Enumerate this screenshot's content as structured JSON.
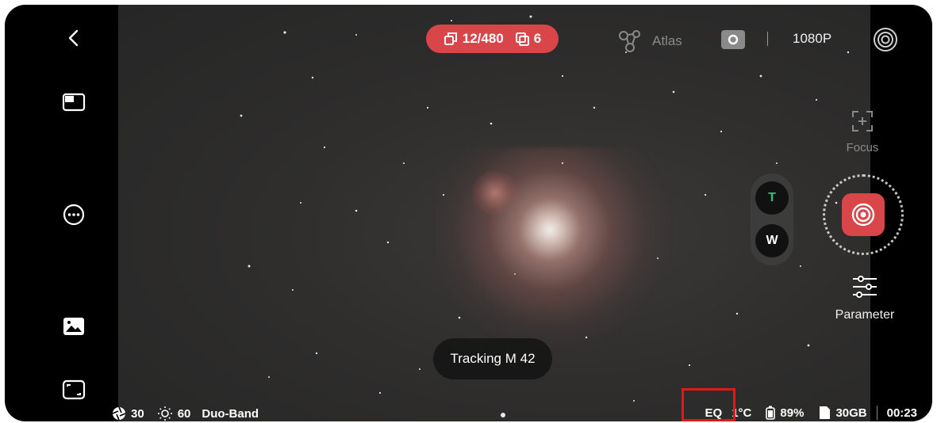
{
  "top_status": {
    "frames_label": "12/480",
    "stack_label": "6",
    "badge_color": "#d9464a"
  },
  "top_bar": {
    "atlas_label": "Atlas",
    "resolution_label": "1080P"
  },
  "right_panel": {
    "focus_label": "Focus",
    "tele_label": "T",
    "wide_label": "W",
    "parameter_label": "Parameter"
  },
  "toast": {
    "text": "Tracking M 42"
  },
  "bottom_left": {
    "exposure_value": "30",
    "gain_value": "60",
    "filter_label": "Duo-Band"
  },
  "bottom_right": {
    "mount_mode": "EQ",
    "temperature": "1°C",
    "battery": "89%",
    "storage": "30GB",
    "elapsed_time": "00:23"
  },
  "icons": {
    "back": "back-arrow-icon",
    "layout": "layout-toggle-icon",
    "more": "more-options-icon",
    "gallery": "gallery-icon",
    "fullscreen": "fullscreen-icon",
    "settings": "target-settings-icon",
    "shutter": "shutter-icon",
    "parameter": "sliders-icon"
  }
}
